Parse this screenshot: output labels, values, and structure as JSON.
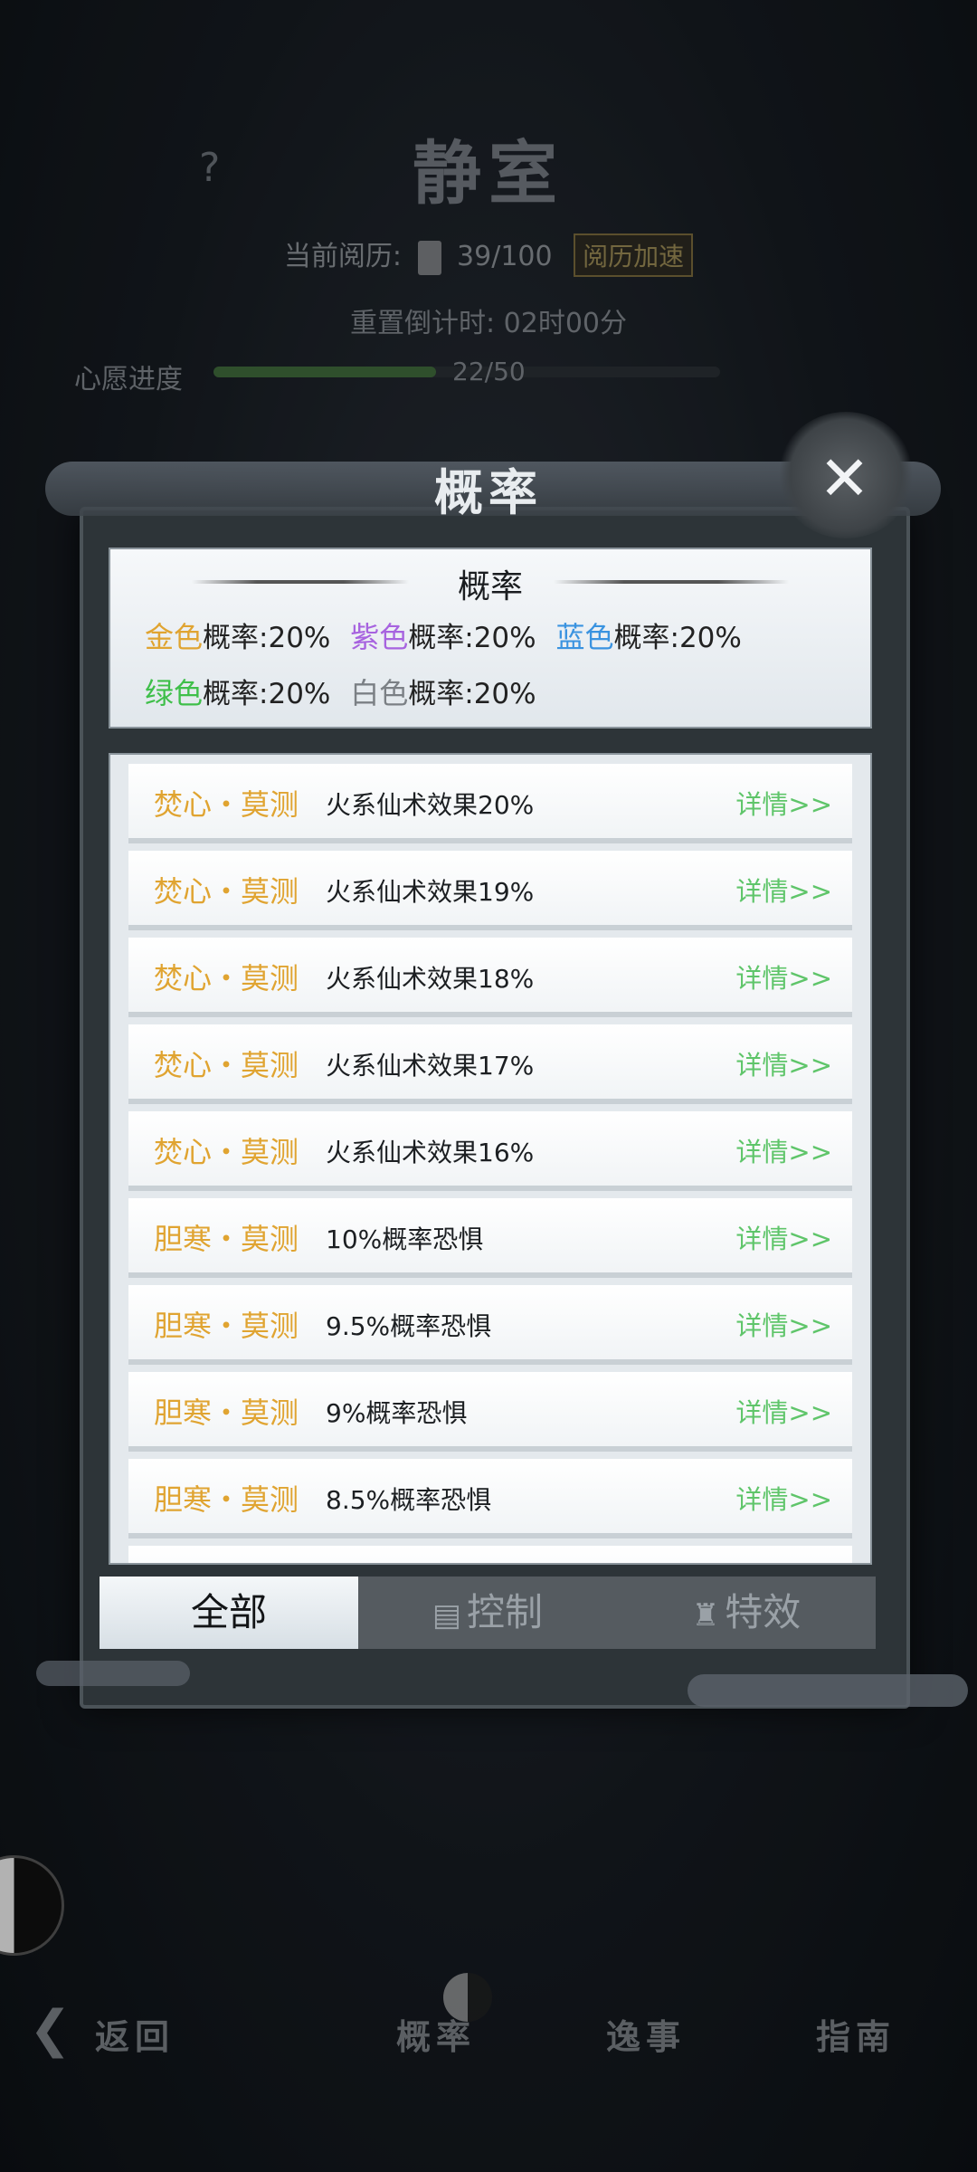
{
  "background": {
    "help_icon": "?",
    "title": "静室",
    "experience_label": "当前阅历:",
    "experience_value": "39/100",
    "speed_button": "阅历加速",
    "countdown_label": "重置倒计时:",
    "countdown_value": "02时00分",
    "wish_label": "心愿进度",
    "wish_value": "22/50",
    "wish_progress": 0.44
  },
  "modal": {
    "title": "概率",
    "close_icon": "✕",
    "summary": {
      "heading": "概率",
      "gold": {
        "color_name": "金色",
        "label": "概率:",
        "value": "20%",
        "color": "#e0a431"
      },
      "purple": {
        "color_name": "紫色",
        "label": "概率:",
        "value": "20%",
        "color": "#a763df"
      },
      "blue": {
        "color_name": "蓝色",
        "label": "概率:",
        "value": "20%",
        "color": "#3a93e0"
      },
      "green": {
        "color_name": "绿色",
        "label": "概率:",
        "value": "20%",
        "color": "#3fbf4a"
      },
      "white": {
        "color_name": "白色",
        "label": "概率:",
        "value": "20%",
        "color": "#7b8085"
      }
    },
    "items": [
      {
        "name": "焚心・莫测",
        "desc": "火系仙术效果20%",
        "detail": "详情>>"
      },
      {
        "name": "焚心・莫测",
        "desc": "火系仙术效果19%",
        "detail": "详情>>"
      },
      {
        "name": "焚心・莫测",
        "desc": "火系仙术效果18%",
        "detail": "详情>>"
      },
      {
        "name": "焚心・莫测",
        "desc": "火系仙术效果17%",
        "detail": "详情>>"
      },
      {
        "name": "焚心・莫测",
        "desc": "火系仙术效果16%",
        "detail": "详情>>"
      },
      {
        "name": "胆寒・莫测",
        "desc": "10%概率恐惧",
        "detail": "详情>>"
      },
      {
        "name": "胆寒・莫测",
        "desc": "9.5%概率恐惧",
        "detail": "详情>>"
      },
      {
        "name": "胆寒・莫测",
        "desc": "9%概率恐惧",
        "detail": "详情>>"
      },
      {
        "name": "胆寒・莫测",
        "desc": "8.5%概率恐惧",
        "detail": "详情>>"
      }
    ],
    "tabs": {
      "all": "全部",
      "control": "控制",
      "effect": "特效"
    }
  },
  "bottom_nav": {
    "back": "返回",
    "probability": "概率",
    "events": "逸事",
    "guide": "指南"
  }
}
